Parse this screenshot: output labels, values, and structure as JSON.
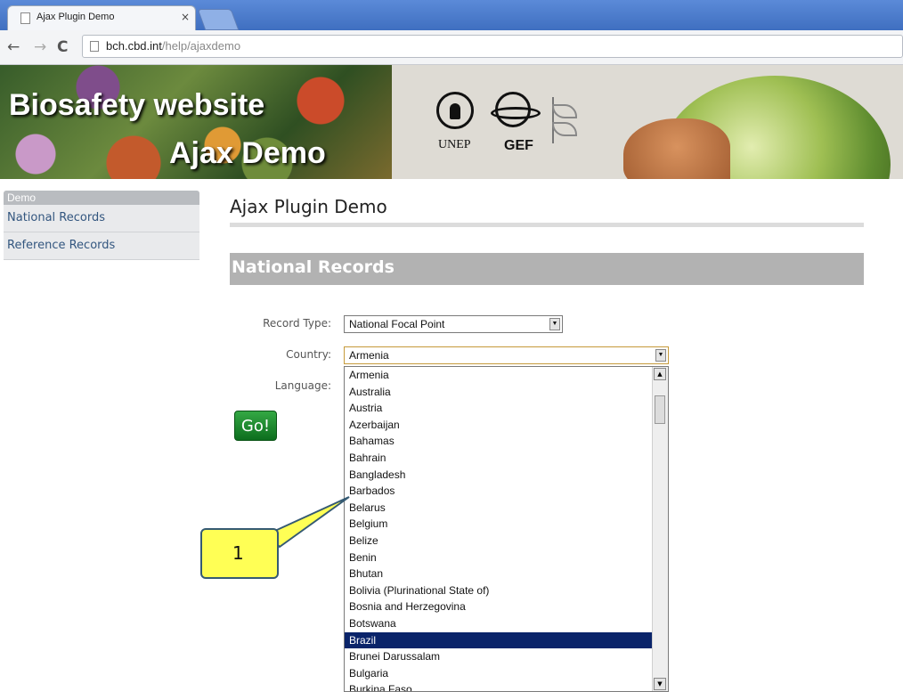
{
  "browser": {
    "tab_title": "Ajax Plugin Demo",
    "tab_close": "×",
    "url_host": "bch.cbd.int",
    "url_path": "/help/ajaxdemo",
    "back": "←",
    "forward": "→",
    "reload": "C"
  },
  "banner": {
    "title": "Biosafety website",
    "subtitle": "Ajax Demo",
    "logo_unep": "UNEP",
    "logo_gef": "GEF"
  },
  "sidebar": {
    "heading": "Demo",
    "items": [
      {
        "label": "National Records"
      },
      {
        "label": "Reference Records"
      }
    ]
  },
  "main": {
    "page_title": "Ajax Plugin Demo",
    "section_title": "National Records",
    "form": {
      "record_type_label": "Record Type:",
      "record_type_value": "National Focal Point",
      "country_label": "Country:",
      "country_value": "Armenia",
      "language_label": "Language:",
      "go_label": "Go!"
    },
    "country_options": [
      "Armenia",
      "Australia",
      "Austria",
      "Azerbaijan",
      "Bahamas",
      "Bahrain",
      "Bangladesh",
      "Barbados",
      "Belarus",
      "Belgium",
      "Belize",
      "Benin",
      "Bhutan",
      "Bolivia (Plurinational State of)",
      "Bosnia and Herzegovina",
      "Botswana",
      "Brazil",
      "Brunei Darussalam",
      "Bulgaria",
      "Burkina Faso"
    ],
    "selected_option": "Brazil"
  },
  "callout": {
    "number": "1",
    "color": "#ffff55"
  }
}
